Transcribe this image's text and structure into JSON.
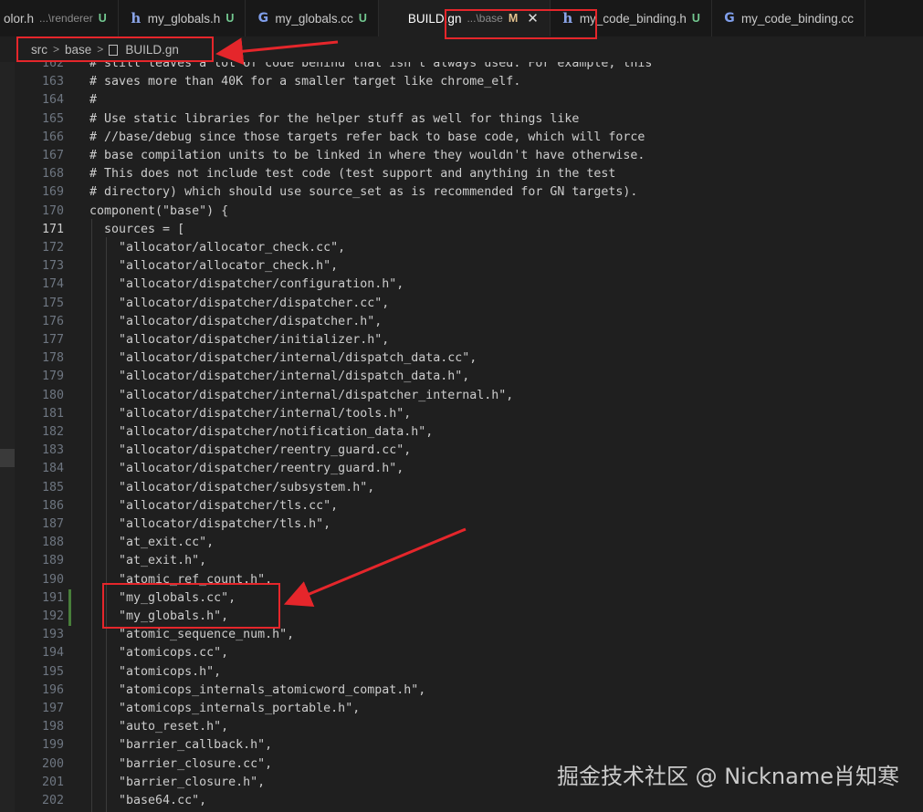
{
  "tabs": [
    {
      "name": "olor.h",
      "desc": "...\\renderer",
      "status": "U",
      "icon": "h"
    },
    {
      "name": "my_globals.h",
      "desc": "",
      "status": "U",
      "icon": "h"
    },
    {
      "name": "my_globals.cc",
      "desc": "",
      "status": "U",
      "icon": "cpp"
    },
    {
      "name": "BUILD.gn",
      "desc": "...\\base",
      "status": "M",
      "icon": "gn",
      "active": true
    },
    {
      "name": "my_code_binding.h",
      "desc": "",
      "status": "U",
      "icon": "h"
    },
    {
      "name": "my_code_binding.cc",
      "desc": "",
      "status": "",
      "icon": "cpp"
    }
  ],
  "breadcrumb": {
    "parts": [
      "src",
      "base"
    ],
    "file": "BUILD.gn"
  },
  "editor": {
    "current_line": 171,
    "modified_lines": [
      191,
      192
    ],
    "lines": [
      {
        "n": 162,
        "t": "# still leaves a lot of code behind that isn't always used. For example, this"
      },
      {
        "n": 163,
        "t": "# saves more than 40K for a smaller target like chrome_elf."
      },
      {
        "n": 164,
        "t": "#"
      },
      {
        "n": 165,
        "t": "# Use static libraries for the helper stuff as well for things like"
      },
      {
        "n": 166,
        "t": "# //base/debug since those targets refer back to base code, which will force"
      },
      {
        "n": 167,
        "t": "# base compilation units to be linked in where they wouldn't have otherwise."
      },
      {
        "n": 168,
        "t": "# This does not include test code (test support and anything in the test"
      },
      {
        "n": 169,
        "t": "# directory) which should use source_set as is recommended for GN targets)."
      },
      {
        "n": 170,
        "t": "component(\"base\") {"
      },
      {
        "n": 171,
        "t": "  sources = ["
      },
      {
        "n": 172,
        "t": "    \"allocator/allocator_check.cc\","
      },
      {
        "n": 173,
        "t": "    \"allocator/allocator_check.h\","
      },
      {
        "n": 174,
        "t": "    \"allocator/dispatcher/configuration.h\","
      },
      {
        "n": 175,
        "t": "    \"allocator/dispatcher/dispatcher.cc\","
      },
      {
        "n": 176,
        "t": "    \"allocator/dispatcher/dispatcher.h\","
      },
      {
        "n": 177,
        "t": "    \"allocator/dispatcher/initializer.h\","
      },
      {
        "n": 178,
        "t": "    \"allocator/dispatcher/internal/dispatch_data.cc\","
      },
      {
        "n": 179,
        "t": "    \"allocator/dispatcher/internal/dispatch_data.h\","
      },
      {
        "n": 180,
        "t": "    \"allocator/dispatcher/internal/dispatcher_internal.h\","
      },
      {
        "n": 181,
        "t": "    \"allocator/dispatcher/internal/tools.h\","
      },
      {
        "n": 182,
        "t": "    \"allocator/dispatcher/notification_data.h\","
      },
      {
        "n": 183,
        "t": "    \"allocator/dispatcher/reentry_guard.cc\","
      },
      {
        "n": 184,
        "t": "    \"allocator/dispatcher/reentry_guard.h\","
      },
      {
        "n": 185,
        "t": "    \"allocator/dispatcher/subsystem.h\","
      },
      {
        "n": 186,
        "t": "    \"allocator/dispatcher/tls.cc\","
      },
      {
        "n": 187,
        "t": "    \"allocator/dispatcher/tls.h\","
      },
      {
        "n": 188,
        "t": "    \"at_exit.cc\","
      },
      {
        "n": 189,
        "t": "    \"at_exit.h\","
      },
      {
        "n": 190,
        "t": "    \"atomic_ref_count.h\","
      },
      {
        "n": 191,
        "t": "    \"my_globals.cc\","
      },
      {
        "n": 192,
        "t": "    \"my_globals.h\","
      },
      {
        "n": 193,
        "t": "    \"atomic_sequence_num.h\","
      },
      {
        "n": 194,
        "t": "    \"atomicops.cc\","
      },
      {
        "n": 195,
        "t": "    \"atomicops.h\","
      },
      {
        "n": 196,
        "t": "    \"atomicops_internals_atomicword_compat.h\","
      },
      {
        "n": 197,
        "t": "    \"atomicops_internals_portable.h\","
      },
      {
        "n": 198,
        "t": "    \"auto_reset.h\","
      },
      {
        "n": 199,
        "t": "    \"barrier_callback.h\","
      },
      {
        "n": 200,
        "t": "    \"barrier_closure.cc\","
      },
      {
        "n": 201,
        "t": "    \"barrier_closure.h\","
      },
      {
        "n": 202,
        "t": "    \"base64.cc\","
      }
    ]
  },
  "watermark": "掘金技术社区 @ Nickname肖知寒",
  "colors": {
    "annotation": "#e5262b",
    "modified_gutter": "#487e3a",
    "untracked": "#73c991",
    "modified": "#e2c08d"
  }
}
